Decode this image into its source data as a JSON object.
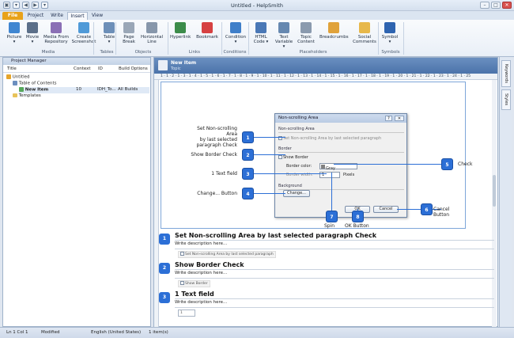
{
  "window": {
    "title": "Untitled - HelpSmith"
  },
  "qat": [
    "▣",
    "▾",
    "◀",
    "▶",
    "▾"
  ],
  "window_buttons": [
    "–",
    "□",
    "✕"
  ],
  "tabs": [
    "File",
    "Project",
    "Write",
    "Insert",
    "View"
  ],
  "ribbon": {
    "buttons": [
      {
        "l1": "Picture",
        "l2": "▾",
        "color": "#3f86d1"
      },
      {
        "l1": "Movie",
        "l2": "▾",
        "color": "#5b6f89"
      },
      {
        "l1": "Media From",
        "l2": "Repository",
        "color": "#8a6fb5"
      },
      {
        "l1": "Create",
        "l2": "Screenshot",
        "color": "#4f9ad8"
      },
      {
        "l1": "Table",
        "l2": "▾",
        "color": "#6d8fb8"
      },
      {
        "l1": "Page",
        "l2": "Break",
        "color": "#9aa7b7"
      },
      {
        "l1": "Horizontal",
        "l2": "Line",
        "color": "#8797ab"
      },
      {
        "l1": "Hyperlink",
        "l2": "",
        "color": "#3c8c4a"
      },
      {
        "l1": "Bookmark",
        "l2": "",
        "color": "#d64141"
      },
      {
        "l1": "Condition",
        "l2": "▾",
        "color": "#3f7fc9"
      },
      {
        "l1": "HTML",
        "l2": "Code ▾",
        "color": "#4a78b6"
      },
      {
        "l1": "Text",
        "l2": "Variable ▾",
        "color": "#6688b0"
      },
      {
        "l1": "Topic",
        "l2": "Content",
        "color": "#8a9aae"
      },
      {
        "l1": "Breadcrumbs",
        "l2": "",
        "color": "#e0a23a"
      },
      {
        "l1": "Social",
        "l2": "Comments",
        "color": "#e7b84a"
      },
      {
        "l1": "Symbol",
        "l2": "▾",
        "color": "#2e64b0"
      }
    ],
    "groups": [
      "Media",
      "Tables",
      "Objects",
      "Links",
      "Conditions",
      "Placeholders",
      "Symbols"
    ]
  },
  "project_manager": {
    "title": "Project Manager",
    "columns": [
      "Title",
      "Context",
      "ID",
      "Build Options"
    ],
    "tree": [
      {
        "label": "Untitled"
      },
      {
        "label": "Table of Contents"
      },
      {
        "label": "New Item",
        "context": "10",
        "id": "IDH_To...",
        "build": "All Builds"
      },
      {
        "label": "Templates"
      }
    ]
  },
  "editor": {
    "doc_title": "New Item",
    "doc_subtitle": "Topic",
    "ruler_text": "1 · 1 · 2 · 1 · 3 · 1 · 4 · 1 · 5 · 1 · 6 · 1 · 7 · 1 · 8 · 1 · 9 · 1 · 10 · 1 · 11 · 1 · 12 · 1 · 13 · 1 · 14 · 1 · 15 · 1 · 16 · 1 · 17 · 1 · 18 · 1 · 19 · 1 · 20 · 1 · 21 · 1 · 22 · 1 · 23 · 1 · 24 · 1 · 25"
  },
  "dialog": {
    "title": "Non-scrolling Area",
    "help": "?",
    "close": "✕",
    "sec1": "Non-scrolling Area",
    "chk1": "Set Non-scrolling Area by last selected paragraph",
    "sec2": "Border",
    "chk2": "Show Border",
    "border_color_label": "Border color:",
    "border_color_value": "Gray",
    "border_width_label": "Border width:",
    "border_width_value": "1",
    "border_width_unit": "Pixels",
    "sec3": "Background",
    "change_btn": "Change...",
    "ok": "OK",
    "cancel": "Cancel"
  },
  "callouts": [
    {
      "num": "1",
      "label1": "Set Non-scrolling Area",
      "label2": "by last selected",
      "label3": "paragraph Check"
    },
    {
      "num": "2",
      "label": "Show Border Check"
    },
    {
      "num": "3",
      "label": "1 Text field"
    },
    {
      "num": "4",
      "label": "Change... Button"
    },
    {
      "num": "5",
      "label": "Check"
    },
    {
      "num": "6",
      "label": "Cancel Button"
    },
    {
      "num": "7",
      "label": "Spin"
    },
    {
      "num": "8",
      "label": "OK Button"
    }
  ],
  "sections": [
    {
      "num": "1",
      "title": "Set Non-scrolling Area by last selected paragraph Check",
      "desc": "Write description here...",
      "chip": "Set Non-scrolling Area by last selected paragraph"
    },
    {
      "num": "2",
      "title": "Show Border Check",
      "desc": "Write description here...",
      "chip": "Show Border"
    },
    {
      "num": "3",
      "title": "1 Text field",
      "desc": "Write description here...",
      "chip": "1"
    }
  ],
  "right_tabs": [
    "Keywords",
    "Styles"
  ],
  "status": {
    "pos": "Ln 1 Col 1",
    "modified": "Modified",
    "lang": "English (United States)",
    "items": "1 item(s)"
  },
  "colors": {
    "accent": "#2c6fd6",
    "file_tab": "#e8a21a"
  }
}
